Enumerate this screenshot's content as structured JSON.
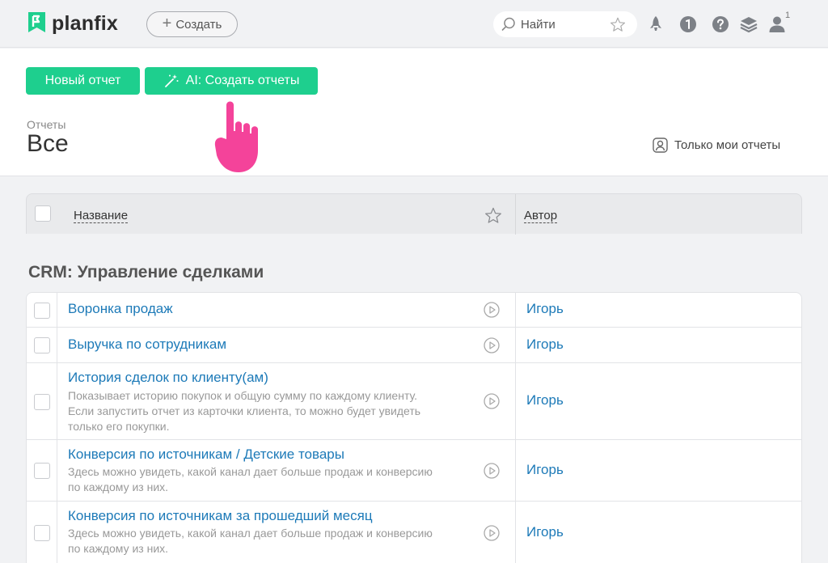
{
  "header": {
    "logo_text": "planfix",
    "create_label": "Создать",
    "search_placeholder": "Найти",
    "user_badge": "1",
    "colors": {
      "brand": "#1ecf8e",
      "link": "#1d7ab8"
    }
  },
  "toolbar": {
    "new_report_label": "Новый отчет",
    "ai_create_label": "AI: Создать отчеты"
  },
  "page": {
    "breadcrumb": "Отчеты",
    "title": "Все",
    "only_mine_label": "Только мои отчеты"
  },
  "table": {
    "col_name": "Название",
    "col_author": "Автор",
    "group_title": "CRM: Управление сделками",
    "rows": [
      {
        "title": "Воронка продаж",
        "desc": [],
        "author": "Игорь"
      },
      {
        "title": "Выручка по сотрудникам",
        "desc": [],
        "author": "Игорь"
      },
      {
        "title": "История сделок по клиенту(ам)",
        "desc": [
          "Показывает историю покупок и общую сумму по каждому клиенту.",
          "Если запустить отчет из карточки клиента, то можно будет увидеть",
          "только его покупки."
        ],
        "author": "Игорь"
      },
      {
        "title": "Конверсия по источникам / Детские товары",
        "desc": [
          "Здесь можно увидеть, какой канал дает больше продаж и конверсию",
          "по каждому из них."
        ],
        "author": "Игорь"
      },
      {
        "title": "Конверсия по источникам за прошедший месяц",
        "desc": [
          "Здесь можно увидеть, какой канал дает больше продаж и конверсию",
          "по каждому из них."
        ],
        "author": "Игорь"
      }
    ]
  }
}
